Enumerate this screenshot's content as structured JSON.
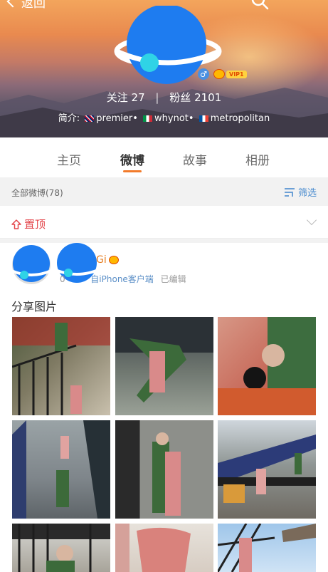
{
  "header": {
    "back_label": "返回",
    "follow_label": "关注",
    "follow_count": "27",
    "separator": "|",
    "fans_label": "粉丝",
    "fans_count": "2101",
    "bio_prefix": "简介:",
    "bio_items": [
      "premier",
      "whynot",
      "metropolitan"
    ],
    "bio_dot": "•",
    "vip_tag": "VIP1",
    "gender_symbol": "♂"
  },
  "tabs": [
    "主页",
    "微博",
    "故事",
    "相册"
  ],
  "active_tab_index": 1,
  "filter": {
    "count_text": "全部微博(78)",
    "button_label": "筛选"
  },
  "pinned": {
    "label": "置顶"
  },
  "post": {
    "name_fragment": "Gi",
    "meta_prefix": "0",
    "meta_source": "自iPhone客户端",
    "meta_suffix": "已编辑",
    "text": "分享图片"
  },
  "colors": {
    "accent_orange": "#f27b2b",
    "link_blue": "#4a8ccf",
    "pinned_red": "#e3464b",
    "sticker_blue": "#1e7cf0",
    "sticker_cyan": "#2fd3e6"
  },
  "icons": [
    "back-chevron-icon",
    "search-icon",
    "gender-male-icon",
    "vip-crown-icon",
    "filter-icon",
    "pin-up-icon",
    "chevron-down-icon",
    "planet-sticker-icon"
  ]
}
